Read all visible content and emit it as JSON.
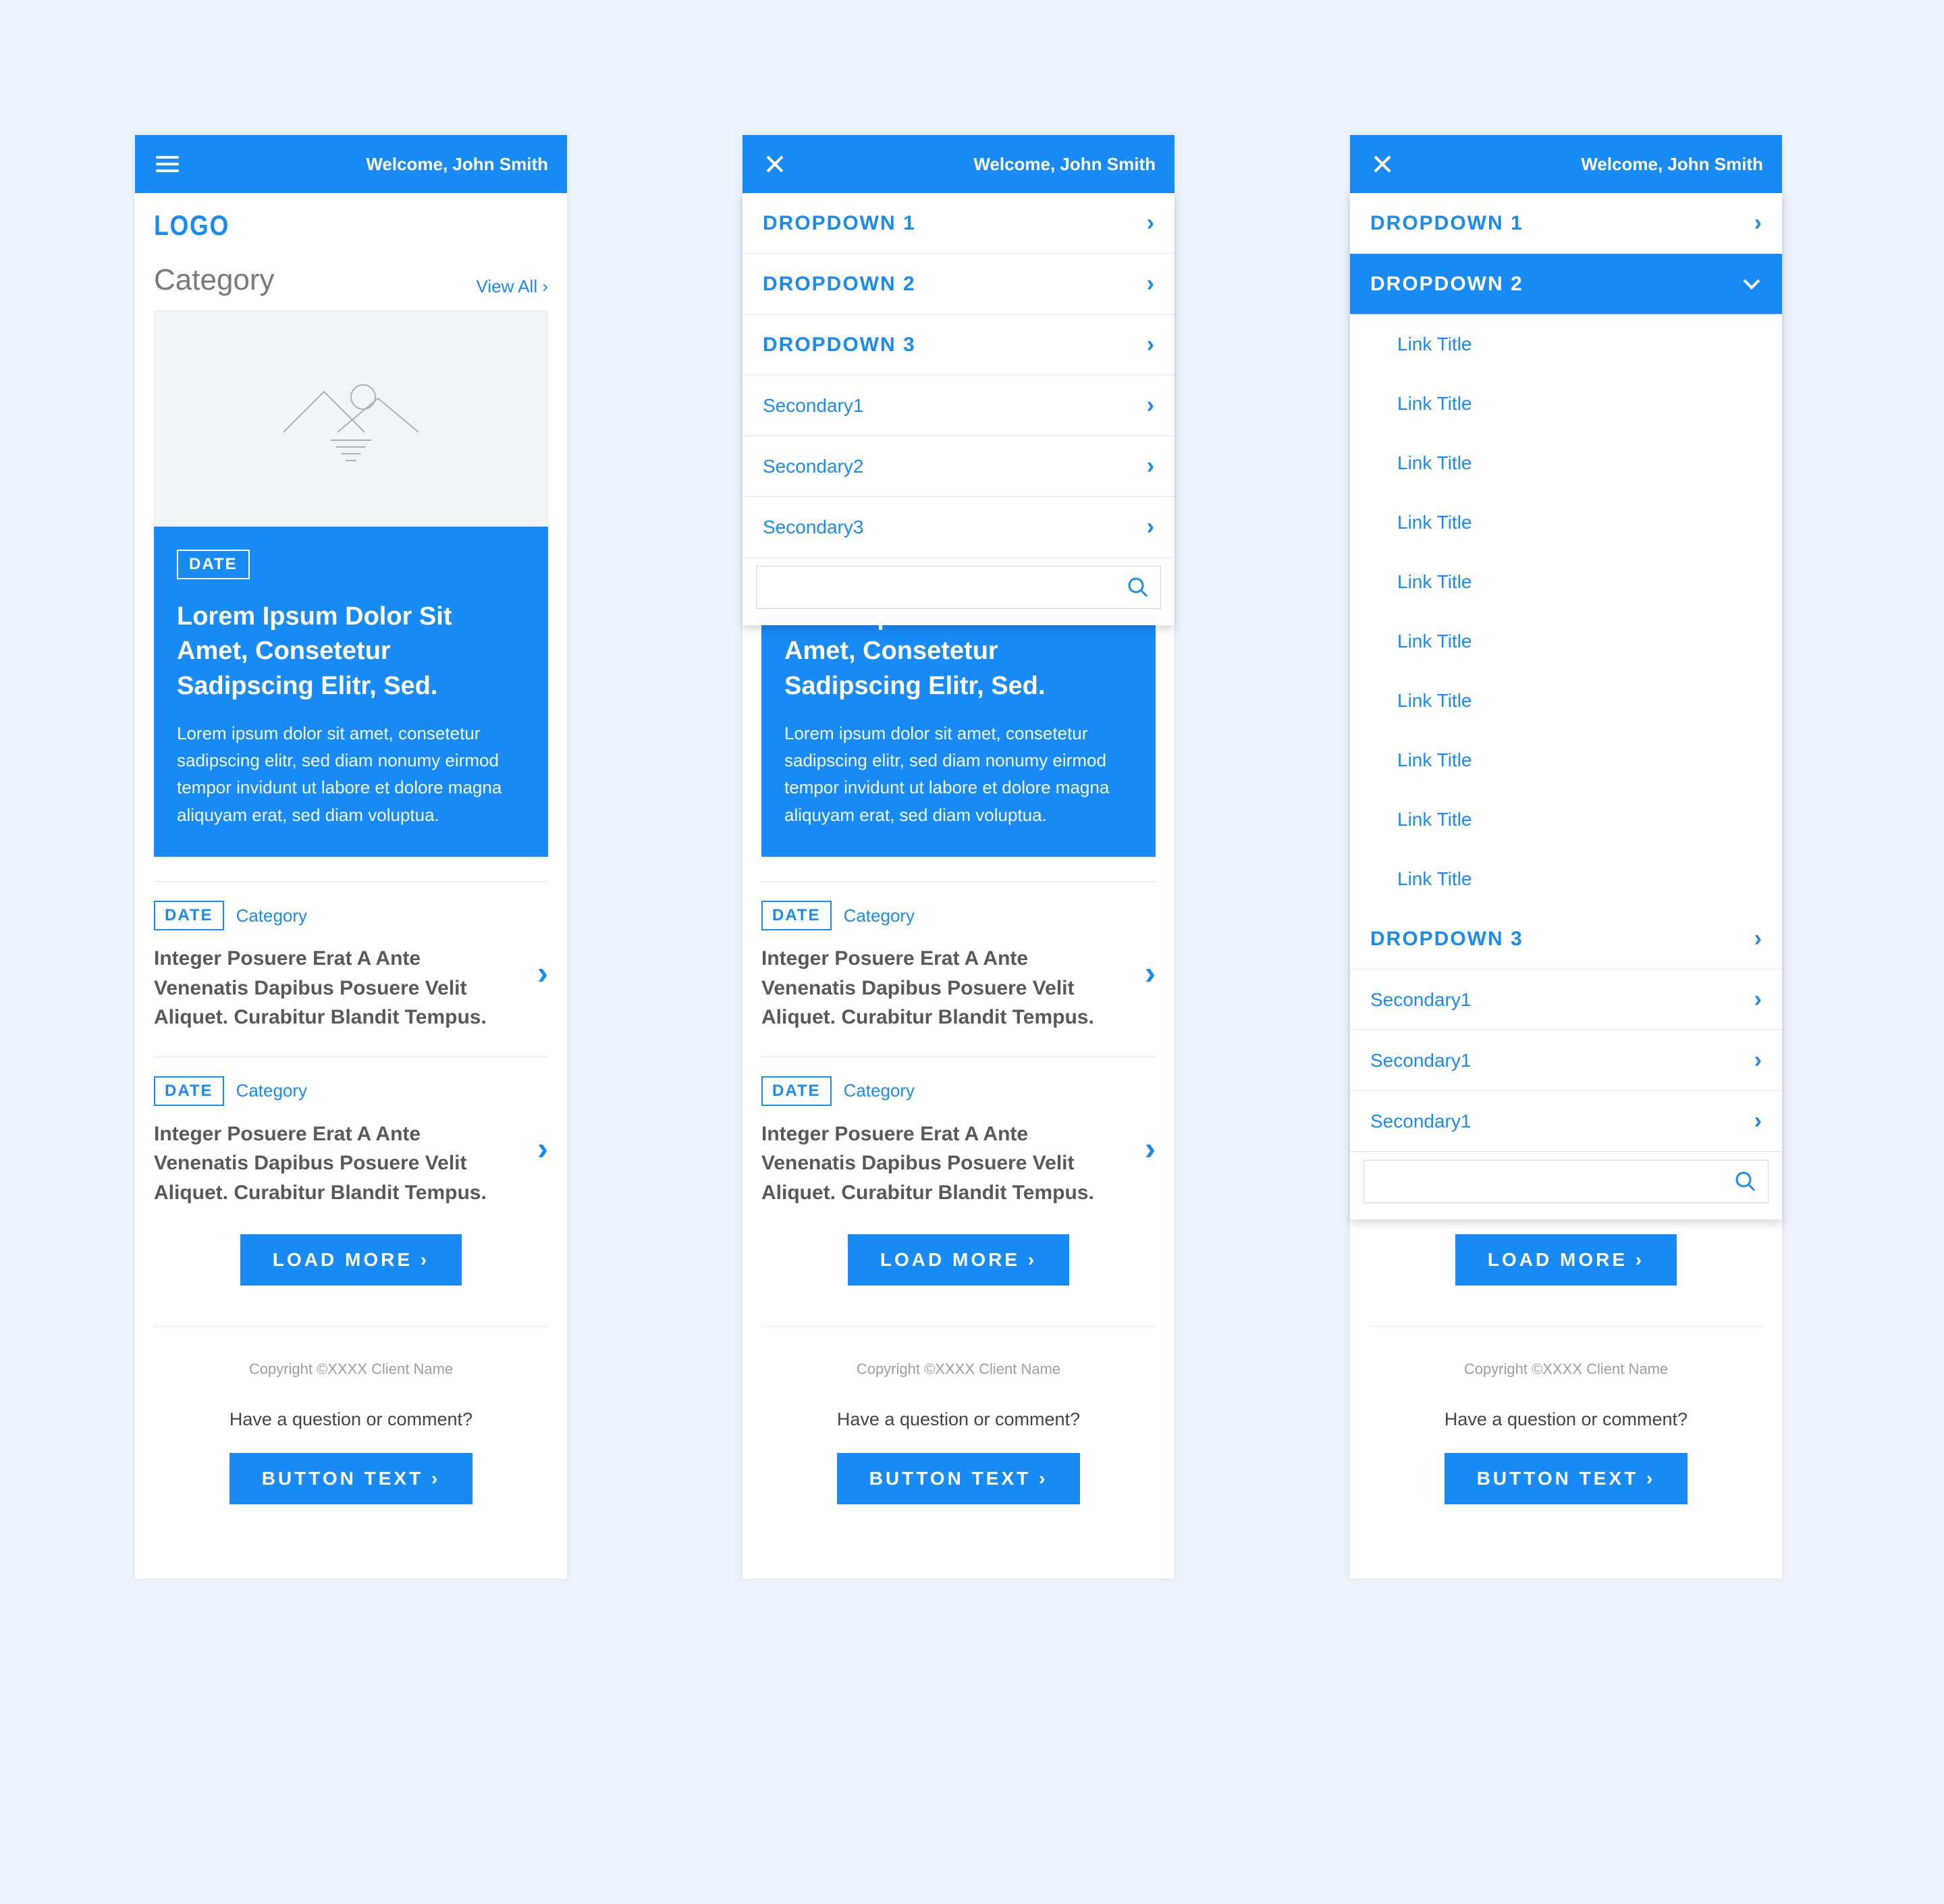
{
  "topbar": {
    "welcome": "Welcome, John Smith"
  },
  "logo": "LOGO",
  "section": {
    "title": "Category",
    "view_all": "View All"
  },
  "hero": {
    "date": "DATE",
    "title": "Lorem Ipsum Dolor Sit Amet, Consetetur Sadipscing Elitr, Sed.",
    "body": "Lorem ipsum dolor sit amet, consetetur sadipscing elitr, sed diam nonumy eirmod tempor invidunt ut labore et dolore magna aliquyam erat, sed diam voluptua."
  },
  "items": [
    {
      "date": "DATE",
      "category": "Category",
      "title": "Integer Posuere Erat A Ante Venenatis Dapibus Posuere Velit Aliquet. Curabitur Blandit Tempus."
    },
    {
      "date": "DATE",
      "category": "Category",
      "title": "Integer Posuere Erat A Ante Venenatis Dapibus Posuere Velit Aliquet. Curabitur Blandit Tempus."
    }
  ],
  "load_more": "LOAD MORE",
  "footer": {
    "copyright": "Copyright ©XXXX Client Name",
    "question": "Have a question or comment?",
    "button": "BUTTON TEXT"
  },
  "menu": {
    "primary": [
      "DROPDOWN 1",
      "DROPDOWN 2",
      "DROPDOWN 3"
    ],
    "secondary_screen2": [
      "Secondary1",
      "Secondary2",
      "Secondary3"
    ],
    "secondary_screen3": [
      "Secondary1",
      "Secondary1",
      "Secondary1"
    ],
    "sublinks": [
      "Link Title",
      "Link Title",
      "Link Title",
      "Link Title",
      "Link Title",
      "Link Title",
      "Link Title",
      "Link Title",
      "Link Title",
      "Link Title"
    ]
  }
}
